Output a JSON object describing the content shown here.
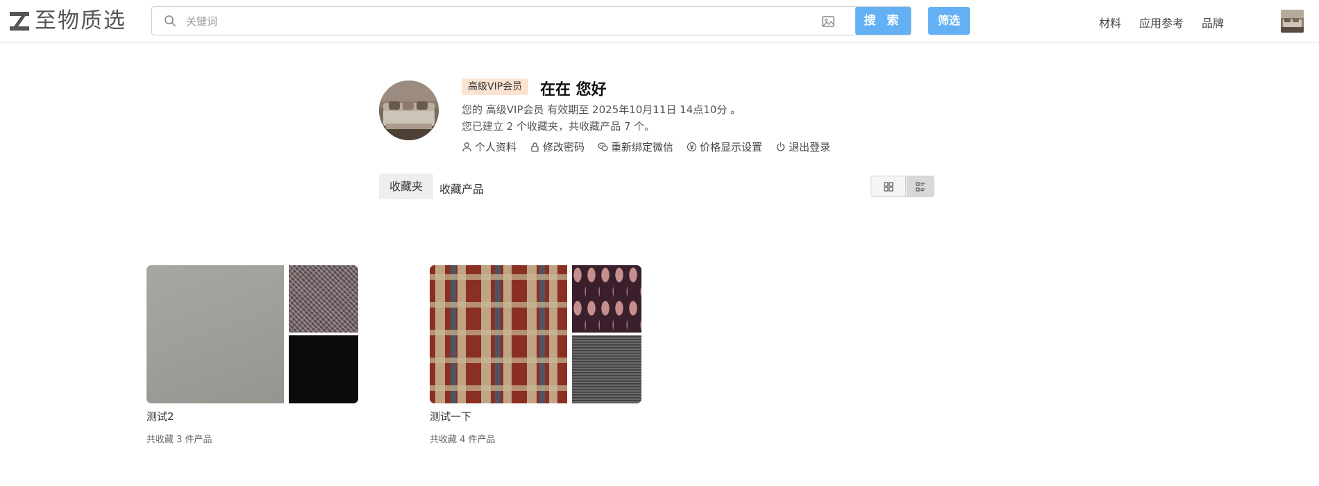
{
  "header": {
    "logo_text": "至物质选",
    "search_placeholder": "关键词",
    "search_button": "搜 索",
    "filter_button": "筛选",
    "nav": [
      "材料",
      "应用参考",
      "品牌"
    ]
  },
  "profile": {
    "vip_badge": "高级VIP会员",
    "greeting": "在在 您好",
    "validity": "您的 高级VIP会员 有效期至 2025年10月11日 14点10分 。",
    "stats": "您已建立 2 个收藏夹，共收藏产品 7 个。",
    "actions": [
      {
        "label": "个人资料",
        "icon": "user-icon"
      },
      {
        "label": "修改密码",
        "icon": "lock-icon"
      },
      {
        "label": "重新绑定微信",
        "icon": "wechat-icon"
      },
      {
        "label": "价格显示设置",
        "icon": "yen-icon"
      },
      {
        "label": "退出登录",
        "icon": "power-icon"
      }
    ]
  },
  "tabs": {
    "favorites": "收藏夹",
    "products": "收藏产品",
    "active": "收藏夹"
  },
  "view_toggle": {
    "options": [
      "grid-icon",
      "list-icon"
    ],
    "selected": "list-icon"
  },
  "folders": [
    {
      "name": "测试2",
      "count": "共收藏 3 件产品"
    },
    {
      "name": "测试一下",
      "count": "共收藏 4 件产品"
    }
  ],
  "colors": {
    "accent": "#63b0f5",
    "vip_badge_bg": "#fbe3d2"
  }
}
